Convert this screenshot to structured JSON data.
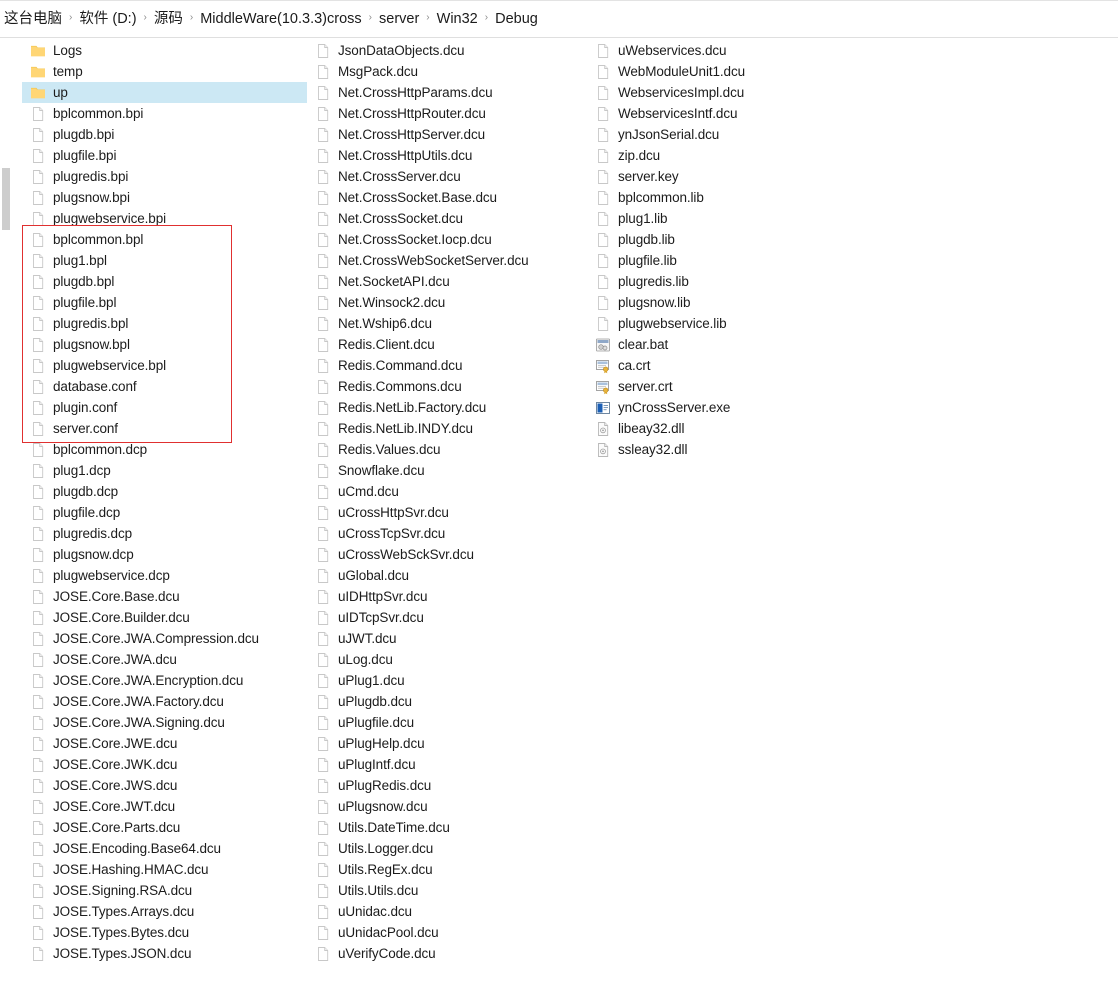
{
  "window": {
    "title": "Debug"
  },
  "breadcrumb": {
    "separator": "›",
    "items": [
      {
        "label": "这台电脑"
      },
      {
        "label": "软件 (D:)"
      },
      {
        "label": "源码"
      },
      {
        "label": "MiddleWare(10.3.3)cross"
      },
      {
        "label": "server"
      },
      {
        "label": "Win32"
      },
      {
        "label": "Debug"
      }
    ]
  },
  "annotation": {
    "highlight_color": "#e03030",
    "selection_color": "#cce8f4",
    "folder_color": "#ffd675",
    "encloses_from": "bplcommon.bpl",
    "encloses_to": "server.conf"
  },
  "columns": [
    {
      "name": "column-1",
      "files": [
        {
          "name": "Logs",
          "icon": "folder-icon",
          "selected": false
        },
        {
          "name": "temp",
          "icon": "folder-icon",
          "selected": false
        },
        {
          "name": "up",
          "icon": "folder-icon",
          "selected": true
        },
        {
          "name": "bplcommon.bpi",
          "icon": "file-icon",
          "selected": false
        },
        {
          "name": "plugdb.bpi",
          "icon": "file-icon",
          "selected": false
        },
        {
          "name": "plugfile.bpi",
          "icon": "file-icon",
          "selected": false
        },
        {
          "name": "plugredis.bpi",
          "icon": "file-icon",
          "selected": false
        },
        {
          "name": "plugsnow.bpi",
          "icon": "file-icon",
          "selected": false
        },
        {
          "name": "plugwebservice.bpi",
          "icon": "file-icon",
          "selected": false
        },
        {
          "name": "bplcommon.bpl",
          "icon": "file-icon",
          "selected": false
        },
        {
          "name": "plug1.bpl",
          "icon": "file-icon",
          "selected": false
        },
        {
          "name": "plugdb.bpl",
          "icon": "file-icon",
          "selected": false
        },
        {
          "name": "plugfile.bpl",
          "icon": "file-icon",
          "selected": false
        },
        {
          "name": "plugredis.bpl",
          "icon": "file-icon",
          "selected": false
        },
        {
          "name": "plugsnow.bpl",
          "icon": "file-icon",
          "selected": false
        },
        {
          "name": "plugwebservice.bpl",
          "icon": "file-icon",
          "selected": false
        },
        {
          "name": "database.conf",
          "icon": "file-icon",
          "selected": false
        },
        {
          "name": "plugin.conf",
          "icon": "file-icon",
          "selected": false
        },
        {
          "name": "server.conf",
          "icon": "file-icon",
          "selected": false
        },
        {
          "name": "bplcommon.dcp",
          "icon": "file-icon",
          "selected": false
        },
        {
          "name": "plug1.dcp",
          "icon": "file-icon",
          "selected": false
        },
        {
          "name": "plugdb.dcp",
          "icon": "file-icon",
          "selected": false
        },
        {
          "name": "plugfile.dcp",
          "icon": "file-icon",
          "selected": false
        },
        {
          "name": "plugredis.dcp",
          "icon": "file-icon",
          "selected": false
        },
        {
          "name": "plugsnow.dcp",
          "icon": "file-icon",
          "selected": false
        },
        {
          "name": "plugwebservice.dcp",
          "icon": "file-icon",
          "selected": false
        },
        {
          "name": "JOSE.Core.Base.dcu",
          "icon": "file-icon",
          "selected": false
        },
        {
          "name": "JOSE.Core.Builder.dcu",
          "icon": "file-icon",
          "selected": false
        },
        {
          "name": "JOSE.Core.JWA.Compression.dcu",
          "icon": "file-icon",
          "selected": false
        },
        {
          "name": "JOSE.Core.JWA.dcu",
          "icon": "file-icon",
          "selected": false
        },
        {
          "name": "JOSE.Core.JWA.Encryption.dcu",
          "icon": "file-icon",
          "selected": false
        },
        {
          "name": "JOSE.Core.JWA.Factory.dcu",
          "icon": "file-icon",
          "selected": false
        },
        {
          "name": "JOSE.Core.JWA.Signing.dcu",
          "icon": "file-icon",
          "selected": false
        },
        {
          "name": "JOSE.Core.JWE.dcu",
          "icon": "file-icon",
          "selected": false
        },
        {
          "name": "JOSE.Core.JWK.dcu",
          "icon": "file-icon",
          "selected": false
        },
        {
          "name": "JOSE.Core.JWS.dcu",
          "icon": "file-icon",
          "selected": false
        },
        {
          "name": "JOSE.Core.JWT.dcu",
          "icon": "file-icon",
          "selected": false
        },
        {
          "name": "JOSE.Core.Parts.dcu",
          "icon": "file-icon",
          "selected": false
        },
        {
          "name": "JOSE.Encoding.Base64.dcu",
          "icon": "file-icon",
          "selected": false
        },
        {
          "name": "JOSE.Hashing.HMAC.dcu",
          "icon": "file-icon",
          "selected": false
        },
        {
          "name": "JOSE.Signing.RSA.dcu",
          "icon": "file-icon",
          "selected": false
        },
        {
          "name": "JOSE.Types.Arrays.dcu",
          "icon": "file-icon",
          "selected": false
        },
        {
          "name": "JOSE.Types.Bytes.dcu",
          "icon": "file-icon",
          "selected": false
        },
        {
          "name": "JOSE.Types.JSON.dcu",
          "icon": "file-icon",
          "selected": false
        }
      ]
    },
    {
      "name": "column-2",
      "files": [
        {
          "name": "JsonDataObjects.dcu",
          "icon": "file-icon",
          "selected": false
        },
        {
          "name": "MsgPack.dcu",
          "icon": "file-icon",
          "selected": false
        },
        {
          "name": "Net.CrossHttpParams.dcu",
          "icon": "file-icon",
          "selected": false
        },
        {
          "name": "Net.CrossHttpRouter.dcu",
          "icon": "file-icon",
          "selected": false
        },
        {
          "name": "Net.CrossHttpServer.dcu",
          "icon": "file-icon",
          "selected": false
        },
        {
          "name": "Net.CrossHttpUtils.dcu",
          "icon": "file-icon",
          "selected": false
        },
        {
          "name": "Net.CrossServer.dcu",
          "icon": "file-icon",
          "selected": false
        },
        {
          "name": "Net.CrossSocket.Base.dcu",
          "icon": "file-icon",
          "selected": false
        },
        {
          "name": "Net.CrossSocket.dcu",
          "icon": "file-icon",
          "selected": false
        },
        {
          "name": "Net.CrossSocket.Iocp.dcu",
          "icon": "file-icon",
          "selected": false
        },
        {
          "name": "Net.CrossWebSocketServer.dcu",
          "icon": "file-icon",
          "selected": false
        },
        {
          "name": "Net.SocketAPI.dcu",
          "icon": "file-icon",
          "selected": false
        },
        {
          "name": "Net.Winsock2.dcu",
          "icon": "file-icon",
          "selected": false
        },
        {
          "name": "Net.Wship6.dcu",
          "icon": "file-icon",
          "selected": false
        },
        {
          "name": "Redis.Client.dcu",
          "icon": "file-icon",
          "selected": false
        },
        {
          "name": "Redis.Command.dcu",
          "icon": "file-icon",
          "selected": false
        },
        {
          "name": "Redis.Commons.dcu",
          "icon": "file-icon",
          "selected": false
        },
        {
          "name": "Redis.NetLib.Factory.dcu",
          "icon": "file-icon",
          "selected": false
        },
        {
          "name": "Redis.NetLib.INDY.dcu",
          "icon": "file-icon",
          "selected": false
        },
        {
          "name": "Redis.Values.dcu",
          "icon": "file-icon",
          "selected": false
        },
        {
          "name": "Snowflake.dcu",
          "icon": "file-icon",
          "selected": false
        },
        {
          "name": "uCmd.dcu",
          "icon": "file-icon",
          "selected": false
        },
        {
          "name": "uCrossHttpSvr.dcu",
          "icon": "file-icon",
          "selected": false
        },
        {
          "name": "uCrossTcpSvr.dcu",
          "icon": "file-icon",
          "selected": false
        },
        {
          "name": "uCrossWebSckSvr.dcu",
          "icon": "file-icon",
          "selected": false
        },
        {
          "name": "uGlobal.dcu",
          "icon": "file-icon",
          "selected": false
        },
        {
          "name": "uIDHttpSvr.dcu",
          "icon": "file-icon",
          "selected": false
        },
        {
          "name": "uIDTcpSvr.dcu",
          "icon": "file-icon",
          "selected": false
        },
        {
          "name": "uJWT.dcu",
          "icon": "file-icon",
          "selected": false
        },
        {
          "name": "uLog.dcu",
          "icon": "file-icon",
          "selected": false
        },
        {
          "name": "uPlug1.dcu",
          "icon": "file-icon",
          "selected": false
        },
        {
          "name": "uPlugdb.dcu",
          "icon": "file-icon",
          "selected": false
        },
        {
          "name": "uPlugfile.dcu",
          "icon": "file-icon",
          "selected": false
        },
        {
          "name": "uPlugHelp.dcu",
          "icon": "file-icon",
          "selected": false
        },
        {
          "name": "uPlugIntf.dcu",
          "icon": "file-icon",
          "selected": false
        },
        {
          "name": "uPlugRedis.dcu",
          "icon": "file-icon",
          "selected": false
        },
        {
          "name": "uPlugsnow.dcu",
          "icon": "file-icon",
          "selected": false
        },
        {
          "name": "Utils.DateTime.dcu",
          "icon": "file-icon",
          "selected": false
        },
        {
          "name": "Utils.Logger.dcu",
          "icon": "file-icon",
          "selected": false
        },
        {
          "name": "Utils.RegEx.dcu",
          "icon": "file-icon",
          "selected": false
        },
        {
          "name": "Utils.Utils.dcu",
          "icon": "file-icon",
          "selected": false
        },
        {
          "name": "uUnidac.dcu",
          "icon": "file-icon",
          "selected": false
        },
        {
          "name": "uUnidacPool.dcu",
          "icon": "file-icon",
          "selected": false
        },
        {
          "name": "uVerifyCode.dcu",
          "icon": "file-icon",
          "selected": false
        }
      ]
    },
    {
      "name": "column-3",
      "files": [
        {
          "name": "uWebservices.dcu",
          "icon": "file-icon",
          "selected": false
        },
        {
          "name": "WebModuleUnit1.dcu",
          "icon": "file-icon",
          "selected": false
        },
        {
          "name": "WebservicesImpl.dcu",
          "icon": "file-icon",
          "selected": false
        },
        {
          "name": "WebservicesIntf.dcu",
          "icon": "file-icon",
          "selected": false
        },
        {
          "name": "ynJsonSerial.dcu",
          "icon": "file-icon",
          "selected": false
        },
        {
          "name": "zip.dcu",
          "icon": "file-icon",
          "selected": false
        },
        {
          "name": "server.key",
          "icon": "file-icon",
          "selected": false
        },
        {
          "name": "bplcommon.lib",
          "icon": "file-icon",
          "selected": false
        },
        {
          "name": "plug1.lib",
          "icon": "file-icon",
          "selected": false
        },
        {
          "name": "plugdb.lib",
          "icon": "file-icon",
          "selected": false
        },
        {
          "name": "plugfile.lib",
          "icon": "file-icon",
          "selected": false
        },
        {
          "name": "plugredis.lib",
          "icon": "file-icon",
          "selected": false
        },
        {
          "name": "plugsnow.lib",
          "icon": "file-icon",
          "selected": false
        },
        {
          "name": "plugwebservice.lib",
          "icon": "file-icon",
          "selected": false
        },
        {
          "name": "clear.bat",
          "icon": "batch-script-icon",
          "selected": false
        },
        {
          "name": "ca.crt",
          "icon": "certificate-icon",
          "selected": false
        },
        {
          "name": "server.crt",
          "icon": "certificate-icon",
          "selected": false
        },
        {
          "name": "ynCrossServer.exe",
          "icon": "application-exe-icon",
          "selected": false
        },
        {
          "name": "libeay32.dll",
          "icon": "dll-library-icon",
          "selected": false
        },
        {
          "name": "ssleay32.dll",
          "icon": "dll-library-icon",
          "selected": false
        }
      ]
    }
  ]
}
